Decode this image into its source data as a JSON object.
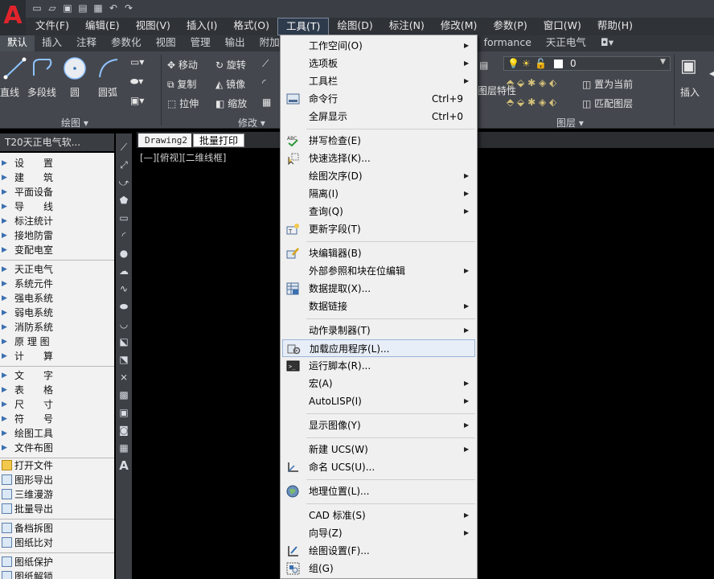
{
  "quick_access": [
    "new",
    "open",
    "save",
    "save-as",
    "print",
    "undo",
    "redo"
  ],
  "menubar": {
    "items": [
      "文件(F)",
      "编辑(E)",
      "视图(V)",
      "插入(I)",
      "格式(O)",
      "工具(T)",
      "绘图(D)",
      "标注(N)",
      "修改(M)",
      "参数(P)",
      "窗口(W)",
      "帮助(H)"
    ],
    "active": "工具(T)"
  },
  "ribbon_tabs": [
    "默认",
    "插入",
    "注释",
    "参数化",
    "视图",
    "管理",
    "输出",
    "附加",
    "formance",
    "天正电气"
  ],
  "ribbon": {
    "draw": {
      "line": "直线",
      "polyline": "多段线",
      "circle": "圆",
      "arc": "圆弧",
      "panel": "绘图"
    },
    "modify": {
      "move": "移动",
      "rotate": "旋转",
      "copy": "复制",
      "mirror": "镜像",
      "stretch": "拉伸",
      "scale": "缩放",
      "panel": "修改"
    },
    "layers": {
      "layer_value": "0",
      "set_current": "置为当前",
      "match_layer": "匹配图层",
      "layer_props": "图层特性",
      "panel": "图层"
    },
    "block": {
      "insert": "插入"
    }
  },
  "palette": {
    "title": "T20天正电气软...",
    "group1": [
      "设　　置",
      "建　　筑",
      "平面设备",
      "导　　线",
      "标注统计",
      "接地防雷",
      "变配电室"
    ],
    "group2": [
      "天正电气",
      "系统元件",
      "强电系统",
      "弱电系统",
      "消防系统",
      "原 理 图",
      "计　　算"
    ],
    "group3": [
      "文　　字",
      "表　　格",
      "尺　　寸",
      "符　　号",
      "绘图工具",
      "文件布图"
    ],
    "group4": [
      "打开文件",
      "图形导出",
      "三维漫游",
      "批量导出"
    ],
    "group5": [
      "备档拆图",
      "图纸比对"
    ],
    "group6": [
      "图纸保护",
      "图纸解锁"
    ]
  },
  "document": {
    "tab_drawing": "Drawing2",
    "tab_batch": "批量打印",
    "viewport_label": "[—][俯视][二维线框]"
  },
  "tools_menu": {
    "items": [
      {
        "label": "工作空间(O)",
        "submenu": true
      },
      {
        "label": "选项板",
        "submenu": true
      },
      {
        "label": "工具栏",
        "submenu": true
      },
      {
        "label": "命令行",
        "shortcut": "Ctrl+9",
        "icon": "command-line-icon"
      },
      {
        "label": "全屏显示",
        "shortcut": "Ctrl+0"
      },
      {
        "label": "拼写检查(E)",
        "icon": "spellcheck-icon"
      },
      {
        "label": "快速选择(K)...",
        "icon": "quick-select-icon"
      },
      {
        "label": "绘图次序(D)",
        "submenu": true
      },
      {
        "label": "隔离(I)",
        "submenu": true
      },
      {
        "label": "查询(Q)",
        "submenu": true
      },
      {
        "label": "更新字段(T)",
        "icon": "update-field-icon"
      },
      {
        "label": "块编辑器(B)",
        "icon": "block-editor-icon"
      },
      {
        "label": "外部参照和块在位编辑",
        "submenu": true
      },
      {
        "label": "数据提取(X)...",
        "icon": "data-extraction-icon"
      },
      {
        "label": "数据链接",
        "submenu": true
      },
      {
        "label": "动作录制器(T)",
        "submenu": true
      },
      {
        "label": "加载应用程序(L)...",
        "icon": "load-app-icon",
        "highlighted": true
      },
      {
        "label": "运行脚本(R)...",
        "icon": "run-script-icon"
      },
      {
        "label": "宏(A)",
        "submenu": true
      },
      {
        "label": "AutoLISP(I)",
        "submenu": true
      },
      {
        "label": "显示图像(Y)",
        "submenu": true
      },
      {
        "label": "新建 UCS(W)",
        "submenu": true
      },
      {
        "label": "命名 UCS(U)...",
        "icon": "named-ucs-icon"
      },
      {
        "label": "地理位置(L)...",
        "icon": "geolocation-icon"
      },
      {
        "label": "CAD 标准(S)",
        "submenu": true
      },
      {
        "label": "向导(Z)",
        "submenu": true
      },
      {
        "label": "绘图设置(F)...",
        "icon": "drafting-settings-icon"
      },
      {
        "label": "组(G)",
        "icon": "group-icon"
      }
    ]
  }
}
